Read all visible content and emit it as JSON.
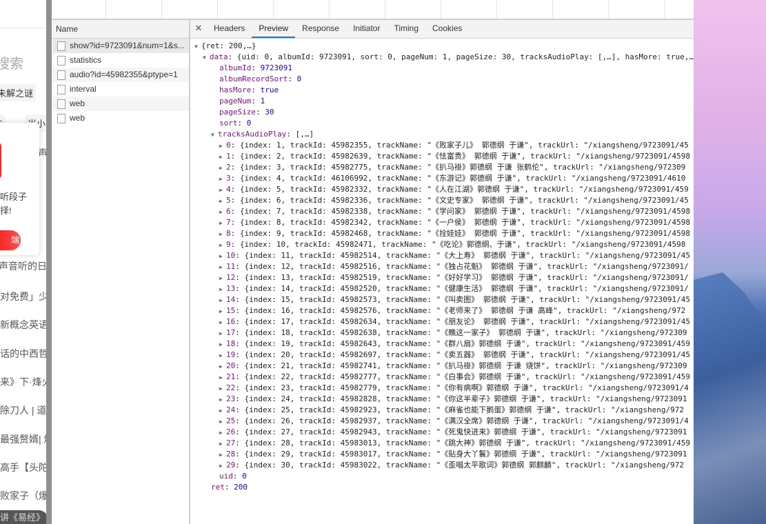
{
  "page": {
    "search_fragment": "搜索",
    "chips": [
      "未解之谜",
      "作",
      "米小"
    ],
    "side_fragment": "声",
    "popup": {
      "line1": "听段子",
      "line2": "择!",
      "button": "端"
    },
    "list_fragments": [
      "声音听的日",
      "对免费」少儿",
      "新概念英语",
      "话的中西哲学",
      "来》下·烽火",
      "除刀人 | 道门",
      "最强赘婿| 爆",
      "高手【头陀渊",
      "败家子（爆笑"
    ],
    "floater": "讲《易经》"
  },
  "network": {
    "name_header": "Name",
    "requests": [
      {
        "name": "show?id=9723091&num=1&s...",
        "selected": true
      },
      {
        "name": "statistics"
      },
      {
        "name": "audio?id=45982355&ptype=1"
      },
      {
        "name": "interval"
      },
      {
        "name": "web"
      },
      {
        "name": "web"
      }
    ]
  },
  "detail": {
    "close_icon": "close-icon",
    "tabs": [
      "Headers",
      "Preview",
      "Response",
      "Initiator",
      "Timing",
      "Cookies"
    ],
    "active_tab": "Preview"
  },
  "preview": {
    "root_summary": "{ret: 200,…}",
    "data_key": "data",
    "data_summary": "{uid: 0, albumId: 9723091, sort: 0, pageNum: 1, pageSize: 30, tracksAudioPlay: [,…], hasMore: true,…}",
    "fields": [
      {
        "key": "albumId",
        "value": "9723091"
      },
      {
        "key": "albumRecordSort",
        "value": "0"
      },
      {
        "key": "hasMore",
        "value": "true"
      },
      {
        "key": "pageNum",
        "value": "1"
      },
      {
        "key": "pageSize",
        "value": "30"
      },
      {
        "key": "sort",
        "value": "0"
      }
    ],
    "tracks_key": "tracksAudioPlay",
    "tracks_summary": "[,…]",
    "tracks": [
      {
        "i": 0,
        "index": 1,
        "trackId": 45982355,
        "trackName": "《败家子儿》 郭德纲 于谦",
        "trackUrl": "/xiangsheng/9723091/45"
      },
      {
        "i": 1,
        "index": 2,
        "trackId": 45982639,
        "trackName": "《怯富贵》 郭德纲 于谦",
        "trackUrl": "/xiangsheng/9723091/4598"
      },
      {
        "i": 2,
        "index": 3,
        "trackId": 45982775,
        "trackName": "《扒马褂》郭德纲 于谦 张鹤伦",
        "trackUrl": "/xiangsheng/972309"
      },
      {
        "i": 3,
        "index": 4,
        "trackId": 46106992,
        "trackName": "《东游记》郭德纲 于谦",
        "trackUrl": "/xiangsheng/9723091/4610"
      },
      {
        "i": 4,
        "index": 5,
        "trackId": 45982332,
        "trackName": "《人在江湖》郭德纲 于谦",
        "trackUrl": "/xiangsheng/9723091/459"
      },
      {
        "i": 5,
        "index": 6,
        "trackId": 45982336,
        "trackName": "《文史专家》 郭德纲 于谦",
        "trackUrl": "/xiangsheng/9723091/45"
      },
      {
        "i": 6,
        "index": 7,
        "trackId": 45982338,
        "trackName": "《学问家》 郭德纲 于谦",
        "trackUrl": "/xiangsheng/9723091/4598"
      },
      {
        "i": 7,
        "index": 8,
        "trackId": 45982342,
        "trackName": "《一户侯》 郭德纲 于谦",
        "trackUrl": "/xiangsheng/9723091/4598"
      },
      {
        "i": 8,
        "index": 9,
        "trackId": 45982468,
        "trackName": "《拴娃娃》 郭德纲 于谦",
        "trackUrl": "/xiangsheng/9723091/4598"
      },
      {
        "i": 9,
        "index": 10,
        "trackId": 45982471,
        "trackName": "《吃论》郭德纲、于谦",
        "trackUrl": "/xiangsheng/9723091/4598"
      },
      {
        "i": 10,
        "index": 11,
        "trackId": 45982514,
        "trackName": "《大上寿》 郭德纲 于谦",
        "trackUrl": "/xiangsheng/9723091/45"
      },
      {
        "i": 11,
        "index": 12,
        "trackId": 45982516,
        "trackName": "《独占花魁》 郭德纲 于谦",
        "trackUrl": "/xiangsheng/9723091/"
      },
      {
        "i": 12,
        "index": 13,
        "trackId": 45982519,
        "trackName": "《好好学习》 郭德纲 于谦",
        "trackUrl": "/xiangsheng/9723091/"
      },
      {
        "i": 13,
        "index": 14,
        "trackId": 45982520,
        "trackName": "《健康生活》 郭德纲 于谦",
        "trackUrl": "/xiangsheng/9723091/"
      },
      {
        "i": 14,
        "index": 15,
        "trackId": 45982573,
        "trackName": "《叫卖图》 郭德纲 于谦",
        "trackUrl": "/xiangsheng/9723091/45"
      },
      {
        "i": 15,
        "index": 16,
        "trackId": 45982576,
        "trackName": "《老师来了》 郭德纲 于谦 高峰",
        "trackUrl": "/xiangsheng/972"
      },
      {
        "i": 16,
        "index": 17,
        "trackId": 45982634,
        "trackName": "《朋友论》 郭德纲 于谦",
        "trackUrl": "/xiangsheng/9723091/45"
      },
      {
        "i": 17,
        "index": 18,
        "trackId": 45982638,
        "trackName": "《瞧这一家子》 郭德纲 于谦",
        "trackUrl": "/xiangsheng/972309"
      },
      {
        "i": 18,
        "index": 19,
        "trackId": 45982643,
        "trackName": "《群八扇》郭德纲 于谦",
        "trackUrl": "/xiangsheng/9723091/459"
      },
      {
        "i": 19,
        "index": 20,
        "trackId": 45982697,
        "trackName": "《卖五器》 郭德纲 于谦",
        "trackUrl": "/xiangsheng/9723091/45"
      },
      {
        "i": 20,
        "index": 21,
        "trackId": 45982741,
        "trackName": "《扒马褂》郭德纲 于谦 烧饼",
        "trackUrl": "/xiangsheng/972309"
      },
      {
        "i": 21,
        "index": 22,
        "trackId": 45982777,
        "trackName": "《白事会》郭德纲 于谦",
        "trackUrl": "/xiangsheng/9723091/459"
      },
      {
        "i": 22,
        "index": 23,
        "trackId": 45982779,
        "trackName": "《你有病啊》郭德纲 于谦",
        "trackUrl": "/xiangsheng/9723091/4"
      },
      {
        "i": 23,
        "index": 24,
        "trackId": 45982828,
        "trackName": "《你这半辈子》郭德纲 于谦",
        "trackUrl": "/xiangsheng/9723091"
      },
      {
        "i": 24,
        "index": 25,
        "trackId": 45982923,
        "trackName": "《麻雀也能下鹅蛋》郭德纲 于谦",
        "trackUrl": "/xiangsheng/972"
      },
      {
        "i": 25,
        "index": 26,
        "trackId": 45982937,
        "trackName": "《满汉全席》郭德纲 于谦",
        "trackUrl": "/xiangsheng/9723091/4"
      },
      {
        "i": 26,
        "index": 27,
        "trackId": 45982943,
        "trackName": "《死鬼快进来》郭德纲 于谦",
        "trackUrl": "/xiangsheng/9723091"
      },
      {
        "i": 27,
        "index": 28,
        "trackId": 45983013,
        "trackName": "《跳大神》郭德纲 于谦",
        "trackUrl": "/xiangsheng/9723091/459"
      },
      {
        "i": 28,
        "index": 29,
        "trackId": 45983017,
        "trackName": "《贴身大丫鬟》郭德纲 于谦",
        "trackUrl": "/xiangsheng/9723091"
      },
      {
        "i": 29,
        "index": 30,
        "trackId": 45983022,
        "trackName": "《歪唱太平歌词》郭德纲 郭麒麟",
        "trackUrl": "/xiangsheng/972"
      }
    ],
    "uid": {
      "key": "uid",
      "value": "0"
    },
    "ret": {
      "key": "ret",
      "value": "200"
    }
  },
  "colors": {
    "key": "#881391",
    "number": "#1c00cf",
    "active_tab": "#1a73e8",
    "brand_red": "#f42b2b"
  }
}
